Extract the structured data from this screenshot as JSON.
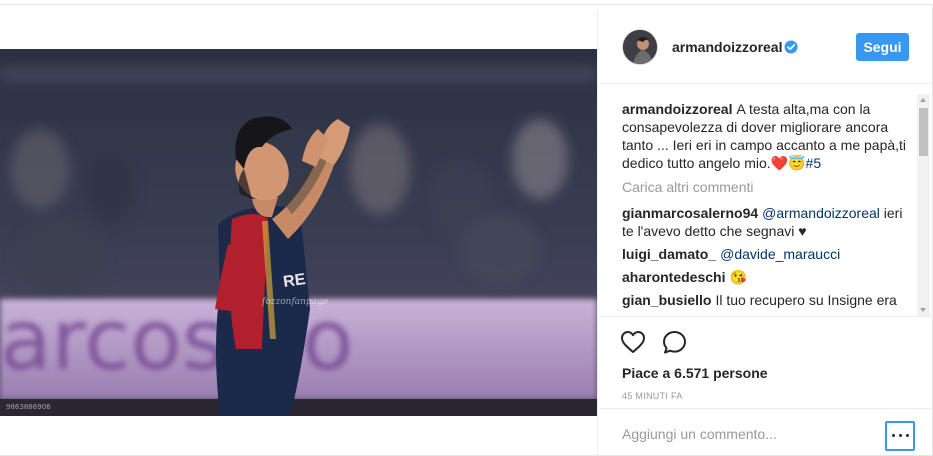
{
  "post": {
    "username": "armandoizzoreal",
    "follow_label": "Segui",
    "caption": {
      "username": "armandoizzoreal",
      "text": "A testa alta,ma con la consapevolezza di dover migliorare ancora tanto ... Ieri eri in campo accanto a me papà,ti dedico tutto angelo mio.",
      "emoji": "❤️😇",
      "hashtag": "#5"
    },
    "load_more_label": "Carica altri commenti",
    "comments": [
      {
        "username": "gianmarcosalerno94",
        "mention": "@armandoizzoreal",
        "text": "ieri te l'avevo detto che segnavi ♥"
      },
      {
        "username": "luigi_damato_",
        "mention": "@davide_maraucci",
        "text": ""
      },
      {
        "username": "aharontedeschi",
        "mention": "",
        "text": "😘"
      },
      {
        "username": "gian_busiello",
        "mention": "",
        "text": "Il tuo recupero su Insigne era"
      }
    ],
    "likes_label": "Piace a 6.571 persone",
    "timestamp": "45 MINUTI FA",
    "comment_placeholder": "Aggiungi un commento...",
    "photo": {
      "banner_text": "arcosino",
      "credit": "9863886906",
      "watermark": "fozzonfanpage",
      "kit_letters": "RE"
    }
  },
  "colors": {
    "accent": "#3897f0",
    "mention": "#003569",
    "muted": "#999999",
    "jersey_red": "#b21f2d",
    "jersey_navy": "#1b2a4a"
  },
  "icons": [
    "verified-icon",
    "heart-icon",
    "comment-icon",
    "more-options-icon"
  ]
}
